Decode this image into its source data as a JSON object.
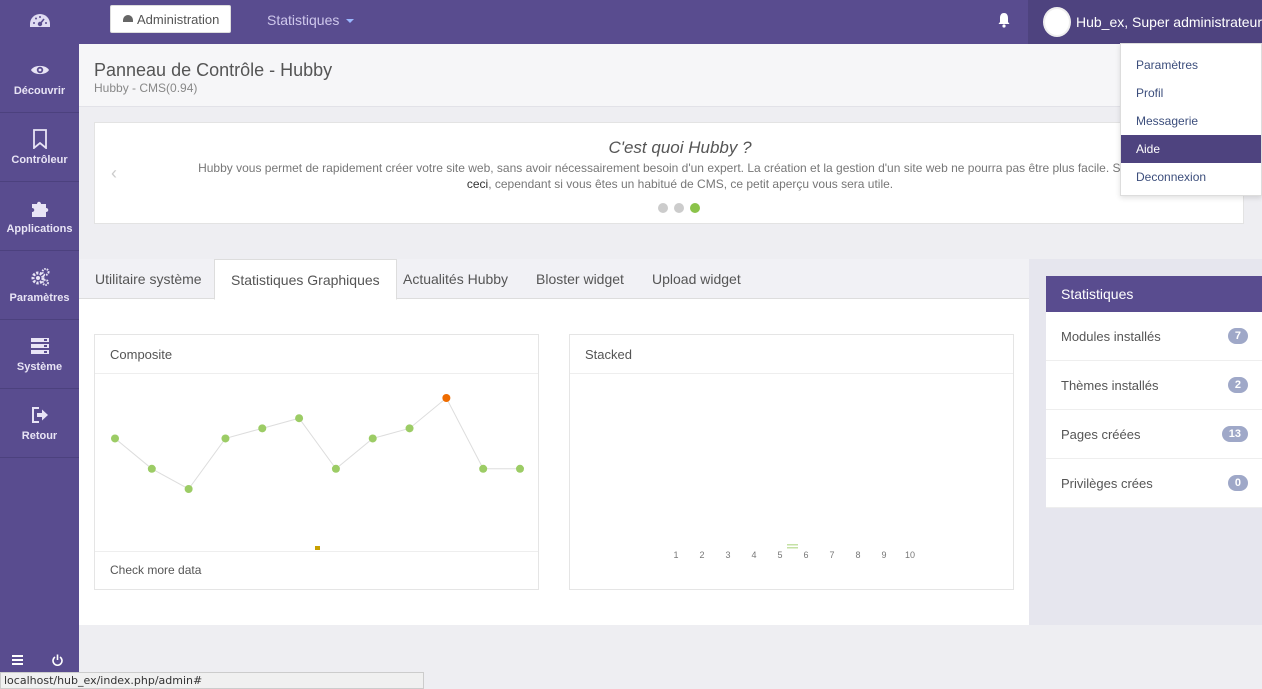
{
  "header": {
    "admin_label": "Administration",
    "stats_label": "Statistiques",
    "user_name": "Hub_ex, Super administrateur"
  },
  "user_menu": [
    {
      "label": "Paramètres",
      "active": false
    },
    {
      "label": "Profil",
      "active": false
    },
    {
      "label": "Messagerie",
      "active": false
    },
    {
      "label": "Aide",
      "active": true
    },
    {
      "label": "Deconnexion",
      "active": false
    }
  ],
  "sidebar": {
    "items": [
      {
        "label": "Découvrir",
        "icon": "eye-icon"
      },
      {
        "label": "Contrôleur",
        "icon": "bookmark-icon"
      },
      {
        "label": "Applications",
        "icon": "puzzle-icon"
      },
      {
        "label": "Paramètres",
        "icon": "gears-icon"
      },
      {
        "label": "Système",
        "icon": "server-icon"
      },
      {
        "label": "Retour",
        "icon": "signout-icon"
      }
    ]
  },
  "page": {
    "title": "Panneau de Contrôle - Hubby",
    "subtitle": "Hubby - CMS(0.94)"
  },
  "carousel": {
    "title": "C'est quoi Hubby ?",
    "line1": "Hubby vous permet de rapidement créer votre site web, sans avoir nécessairement besoin d'un expert. La création et la gestion d'un site web ne pourra pas être plus facile. Si vous débu",
    "line2_link": "ceci",
    "line2_rest": ", cependant si vous êtes un habitué de CMS, ce petit aperçu vous sera utile.",
    "active_slide": 3,
    "slide_count": 3
  },
  "tabs": [
    {
      "label": "Utilitaire système",
      "active": false
    },
    {
      "label": "Statistiques Graphiques",
      "active": true
    },
    {
      "label": "Actualités Hubby",
      "active": false
    },
    {
      "label": "Bloster widget",
      "active": false
    },
    {
      "label": "Upload widget",
      "active": false
    }
  ],
  "composite_card": {
    "title": "Composite",
    "footer": "Check more data"
  },
  "stacked_card": {
    "title": "Stacked"
  },
  "stats_panel": {
    "title": "Statistiques",
    "rows": [
      {
        "label": "Modules installés",
        "count": "7"
      },
      {
        "label": "Thèmes installés",
        "count": "2"
      },
      {
        "label": "Pages créées",
        "count": "13"
      },
      {
        "label": "Privilèges crées",
        "count": "0"
      }
    ]
  },
  "status_url": "localhost/hub_ex/index.php/admin#",
  "chart_data": [
    {
      "type": "line",
      "x": [
        1,
        2,
        3,
        4,
        5,
        6,
        7,
        8,
        9,
        10,
        11,
        12
      ],
      "values": [
        6,
        3,
        1,
        6,
        7,
        8,
        3,
        6,
        7,
        10,
        3,
        3
      ],
      "highlight_index": 9,
      "colors": {
        "point": "#9ccc65",
        "highlight": "#ef6c00",
        "line": "#dddddd"
      }
    },
    {
      "type": "bar",
      "categories": [
        "1",
        "2",
        "3",
        "4",
        "5",
        "6",
        "7",
        "8",
        "9",
        "10"
      ],
      "series": []
    }
  ]
}
